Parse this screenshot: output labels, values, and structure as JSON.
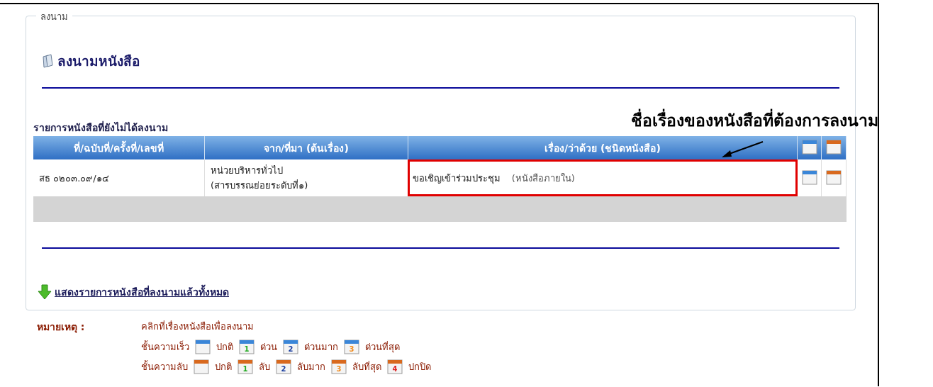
{
  "fieldset": {
    "legend": "ลงนาม"
  },
  "page_title": "ลงนามหนังสือ",
  "table_caption": "รายการหนังสือที่ยังไม่ได้ลงนาม",
  "table": {
    "columns": [
      {
        "kind": "text",
        "label": "ที่/ฉบับที่/ครั้งที่/เลขที่"
      },
      {
        "kind": "text",
        "label": "จาก/ที่มา (ต้นเรื่อง)"
      },
      {
        "kind": "text",
        "label": "เรื่อง/ว่าด้วย (ชนิดหนังสือ)"
      },
      {
        "kind": "speed"
      },
      {
        "kind": "secret"
      }
    ],
    "rows": [
      {
        "number": "สธ ๐๒๐๓.๐๙/๑๔",
        "from_lines": [
          "หน่วยบริหารทั่วไป",
          "(สารบรรณย่อยระดับที่๑)"
        ],
        "subject": "ขอเชิญเข้าร่วมประชุม",
        "doc_type": "(หนังสือภายใน)",
        "highlighted": true,
        "icons": [
          {
            "kind": "speed"
          },
          {
            "kind": "secret"
          }
        ]
      }
    ]
  },
  "annotation": {
    "text": "ชื่อเรื่องของหนังสือที่ต้องการลงนาม"
  },
  "show_all_link": "แสดงรายการหนังสือที่ลงนามแล้วทั้งหมด",
  "notes": {
    "label": "หมายเหตุ :",
    "instruction": "คลิกที่เรื่องหนังสือเพื่อลงนาม",
    "legends": [
      {
        "label": "ชั้นความเร็ว",
        "kind": "speed",
        "items": [
          {
            "text": "ปกติ"
          },
          {
            "digit": "1",
            "color": "#22aa22",
            "text": "ด่วน"
          },
          {
            "digit": "2",
            "color": "#1a3fa0",
            "text": "ด่วนมาก"
          },
          {
            "digit": "3",
            "color": "#f08a1c",
            "text": "ด่วนที่สุด"
          }
        ]
      },
      {
        "label": "ชั้นความลับ",
        "kind": "secret",
        "items": [
          {
            "text": "ปกติ"
          },
          {
            "digit": "1",
            "color": "#22aa22",
            "text": "ลับ"
          },
          {
            "digit": "2",
            "color": "#1a3fa0",
            "text": "ลับมาก"
          },
          {
            "digit": "3",
            "color": "#f08a1c",
            "text": "ลับที่สุด"
          },
          {
            "digit": "4",
            "color": "#dd2222",
            "text": "ปกปิด"
          }
        ]
      }
    ]
  }
}
